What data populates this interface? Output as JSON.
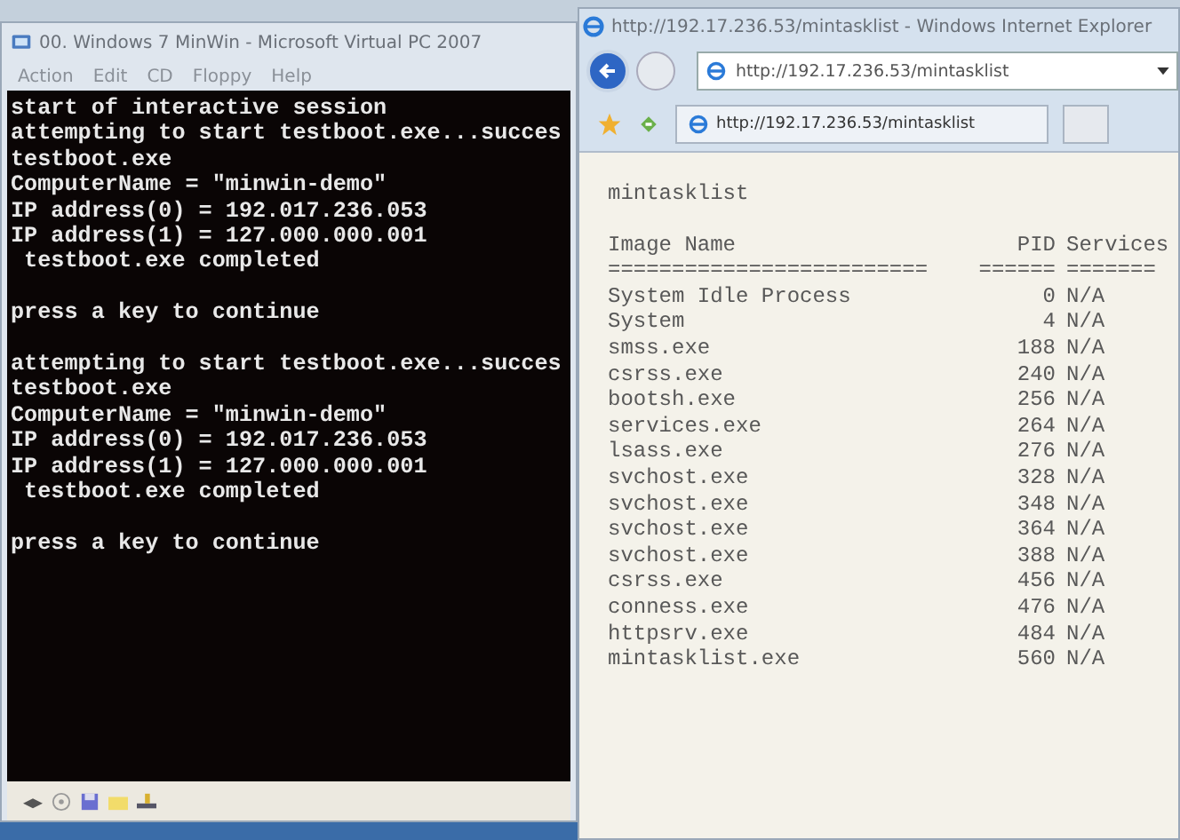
{
  "vpc_window": {
    "title": "00. Windows 7 MinWin - Microsoft Virtual PC 2007",
    "menu": [
      "Action",
      "Edit",
      "CD",
      "Floppy",
      "Help"
    ],
    "console": {
      "blocks": [
        [
          "start of interactive session",
          "attempting to start testboot.exe...succes",
          "testboot.exe",
          "ComputerName = \"minwin-demo\"",
          "IP address(0) = 192.017.236.053",
          "IP address(1) = 127.000.000.001",
          " testboot.exe completed"
        ],
        [
          "press a key to continue"
        ],
        [
          "attempting to start testboot.exe...succes",
          "testboot.exe",
          "ComputerName = \"minwin-demo\"",
          "IP address(0) = 192.017.236.053",
          "IP address(1) = 127.000.000.001",
          " testboot.exe completed"
        ],
        [
          "press a key to continue"
        ]
      ]
    }
  },
  "ie_window": {
    "title": "http://192.17.236.53/mintasklist - Windows Internet Explorer",
    "address": "http://192.17.236.53/mintasklist",
    "tab": {
      "label": "http://192.17.236.53/mintasklist"
    },
    "page": {
      "heading": "mintasklist",
      "columns": [
        "Image Name",
        "PID",
        "Services"
      ],
      "separators": [
        "=========================",
        "======",
        "======="
      ],
      "rows": [
        {
          "name": "System Idle Process",
          "pid": "0",
          "services": "N/A"
        },
        {
          "name": "System",
          "pid": "4",
          "services": "N/A"
        },
        {
          "name": "smss.exe",
          "pid": "188",
          "services": "N/A"
        },
        {
          "name": "csrss.exe",
          "pid": "240",
          "services": "N/A"
        },
        {
          "name": "bootsh.exe",
          "pid": "256",
          "services": "N/A"
        },
        {
          "name": "services.exe",
          "pid": "264",
          "services": "N/A"
        },
        {
          "name": "lsass.exe",
          "pid": "276",
          "services": "N/A"
        },
        {
          "name": "svchost.exe",
          "pid": "328",
          "services": "N/A"
        },
        {
          "name": "svchost.exe",
          "pid": "348",
          "services": "N/A"
        },
        {
          "name": "svchost.exe",
          "pid": "364",
          "services": "N/A"
        },
        {
          "name": "svchost.exe",
          "pid": "388",
          "services": "N/A"
        },
        {
          "name": "csrss.exe",
          "pid": "456",
          "services": "N/A"
        },
        {
          "name": "conness.exe",
          "pid": "476",
          "services": "N/A"
        },
        {
          "name": "httpsrv.exe",
          "pid": "484",
          "services": "N/A"
        },
        {
          "name": "mintasklist.exe",
          "pid": "560",
          "services": "N/A"
        }
      ]
    }
  }
}
